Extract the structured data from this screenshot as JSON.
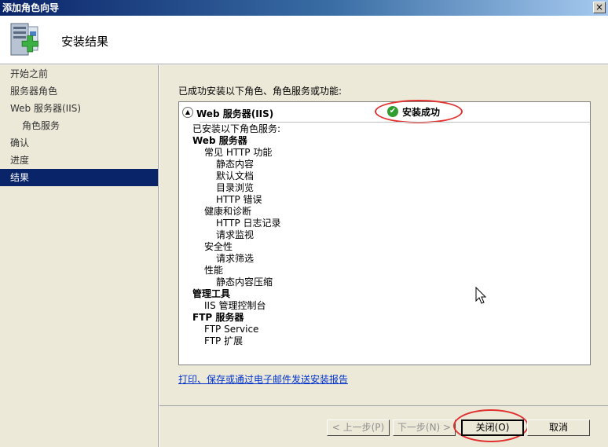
{
  "window": {
    "title": "添加角色向导",
    "close_glyph": "×"
  },
  "header": {
    "title": "安装结果",
    "icon": "server-add-icon"
  },
  "nav": {
    "items": [
      {
        "label": "开始之前",
        "sub": false,
        "active": false
      },
      {
        "label": "服务器角色",
        "sub": false,
        "active": false
      },
      {
        "label": "Web 服务器(IIS)",
        "sub": false,
        "active": false
      },
      {
        "label": "角色服务",
        "sub": true,
        "active": false
      },
      {
        "label": "确认",
        "sub": false,
        "active": false
      },
      {
        "label": "进度",
        "sub": false,
        "active": false
      },
      {
        "label": "结果",
        "sub": false,
        "active": true
      }
    ]
  },
  "main": {
    "intro": "已成功安装以下角色、角色服务或功能:",
    "box": {
      "title": "Web 服务器(IIS)",
      "status": "安装成功",
      "collapse_glyph": "▲",
      "status_glyph": "✔",
      "lines": [
        {
          "text": "已安装以下角色服务:",
          "level": 0
        },
        {
          "text": "Web 服务器",
          "level": 1
        },
        {
          "text": "常见 HTTP 功能",
          "level": 2
        },
        {
          "text": "静态内容",
          "level": 3
        },
        {
          "text": "默认文档",
          "level": 3
        },
        {
          "text": "目录浏览",
          "level": 3
        },
        {
          "text": "HTTP 错误",
          "level": 3
        },
        {
          "text": "健康和诊断",
          "level": 2
        },
        {
          "text": "HTTP 日志记录",
          "level": 3
        },
        {
          "text": "请求监视",
          "level": 3
        },
        {
          "text": "安全性",
          "level": 2
        },
        {
          "text": "请求筛选",
          "level": 3
        },
        {
          "text": "性能",
          "level": 2
        },
        {
          "text": "静态内容压缩",
          "level": 3
        },
        {
          "text": "管理工具",
          "level": 1
        },
        {
          "text": "IIS 管理控制台",
          "level": 2
        },
        {
          "text": "FTP 服务器",
          "level": 1
        },
        {
          "text": "FTP Service",
          "level": 2
        },
        {
          "text": "FTP 扩展",
          "level": 2
        }
      ]
    },
    "report_link": "打印、保存或通过电子邮件发送安装报告"
  },
  "footer": {
    "prev_label": "< 上一步(P)",
    "next_label": "下一步(N) >",
    "close_label": "关闭(O)",
    "cancel_label": "取消"
  },
  "colors": {
    "nav_active": "#0a246a",
    "highlight": "#e03030",
    "success": "#2f9e2f",
    "link": "#0033cc"
  }
}
